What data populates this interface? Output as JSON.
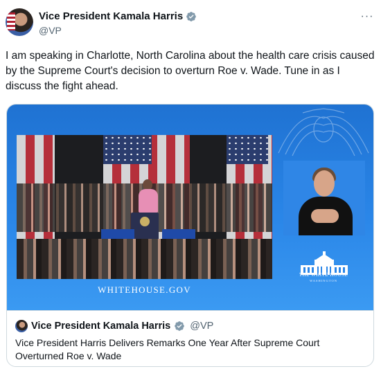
{
  "author": {
    "display_name": "Vice President Kamala Harris",
    "handle": "@VP",
    "verified_icon": "verified-badge-icon",
    "avatar_icon": "profile-avatar"
  },
  "more_icon": "more-horizontal-icon",
  "more_glyph": "···",
  "tweet": {
    "text": "I am speaking in Charlotte, North Carolina about the health care crisis caused by the Supreme Court's decision to overturn Roe v. Wade. Tune in as I discuss the fight ahead."
  },
  "media": {
    "site_url": "WHITEHOUSE.GOV",
    "logo_title": "THE WHITE HOUSE",
    "logo_subtitle": "WASHINGTON",
    "colors": {
      "background": "#2a86e8",
      "accent": "#1f72d2"
    }
  },
  "quoted": {
    "display_name": "Vice President Kamala Harris",
    "handle": "@VP",
    "text": "Vice President Harris Delivers Remarks One Year After Supreme Court Overturned Roe v. Wade"
  },
  "colors": {
    "text_primary": "#0f1419",
    "text_secondary": "#536471",
    "verified": "#829aab",
    "border": "#cfd9de"
  }
}
